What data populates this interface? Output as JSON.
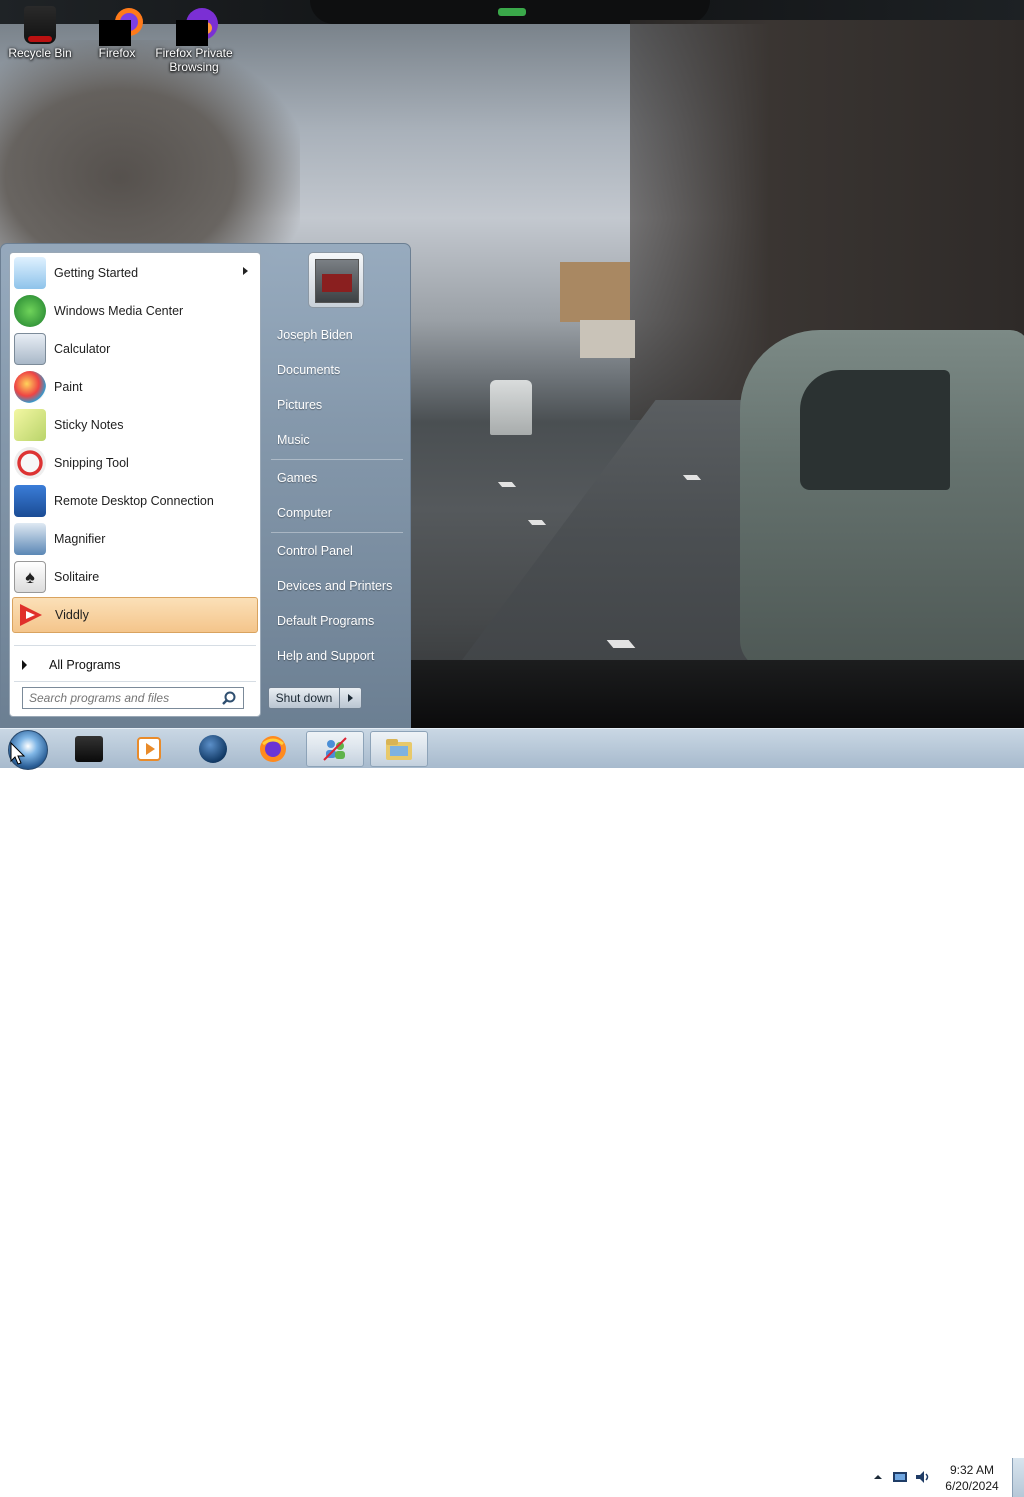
{
  "desktop": {
    "icons": [
      {
        "label": "Recycle Bin"
      },
      {
        "label": "Firefox"
      },
      {
        "label": "Firefox Private Browsing"
      }
    ]
  },
  "start_menu": {
    "programs": [
      {
        "label": "Getting Started",
        "icon": "getting-started-icon",
        "submenu": true
      },
      {
        "label": "Windows Media Center",
        "icon": "windows-media-center-icon"
      },
      {
        "label": "Calculator",
        "icon": "calculator-icon"
      },
      {
        "label": "Paint",
        "icon": "paint-icon"
      },
      {
        "label": "Sticky Notes",
        "icon": "sticky-notes-icon"
      },
      {
        "label": "Snipping Tool",
        "icon": "snipping-tool-icon"
      },
      {
        "label": "Remote Desktop Connection",
        "icon": "remote-desktop-icon"
      },
      {
        "label": "Magnifier",
        "icon": "magnifier-icon"
      },
      {
        "label": "Solitaire",
        "icon": "solitaire-icon"
      },
      {
        "label": "Viddly",
        "icon": "viddly-icon",
        "highlighted": true
      }
    ],
    "all_programs": "All Programs",
    "search_placeholder": "Search programs and files",
    "user_name": "Joseph Biden",
    "right_items": [
      "Documents",
      "Pictures",
      "Music",
      "Games",
      "Computer",
      "Control Panel",
      "Devices and Printers",
      "Default Programs",
      "Help and Support"
    ],
    "shutdown_label": "Shut down",
    "highlight_color": "#f4c58b"
  },
  "taskbar": {
    "pinned": [
      "dark-app-icon",
      "media-player-icon",
      "globe-browser-icon",
      "firefox-icon",
      "network-people-icon",
      "explorer-folder-icon"
    ],
    "clock_time": "9:32 AM",
    "clock_date": "6/20/2024"
  }
}
